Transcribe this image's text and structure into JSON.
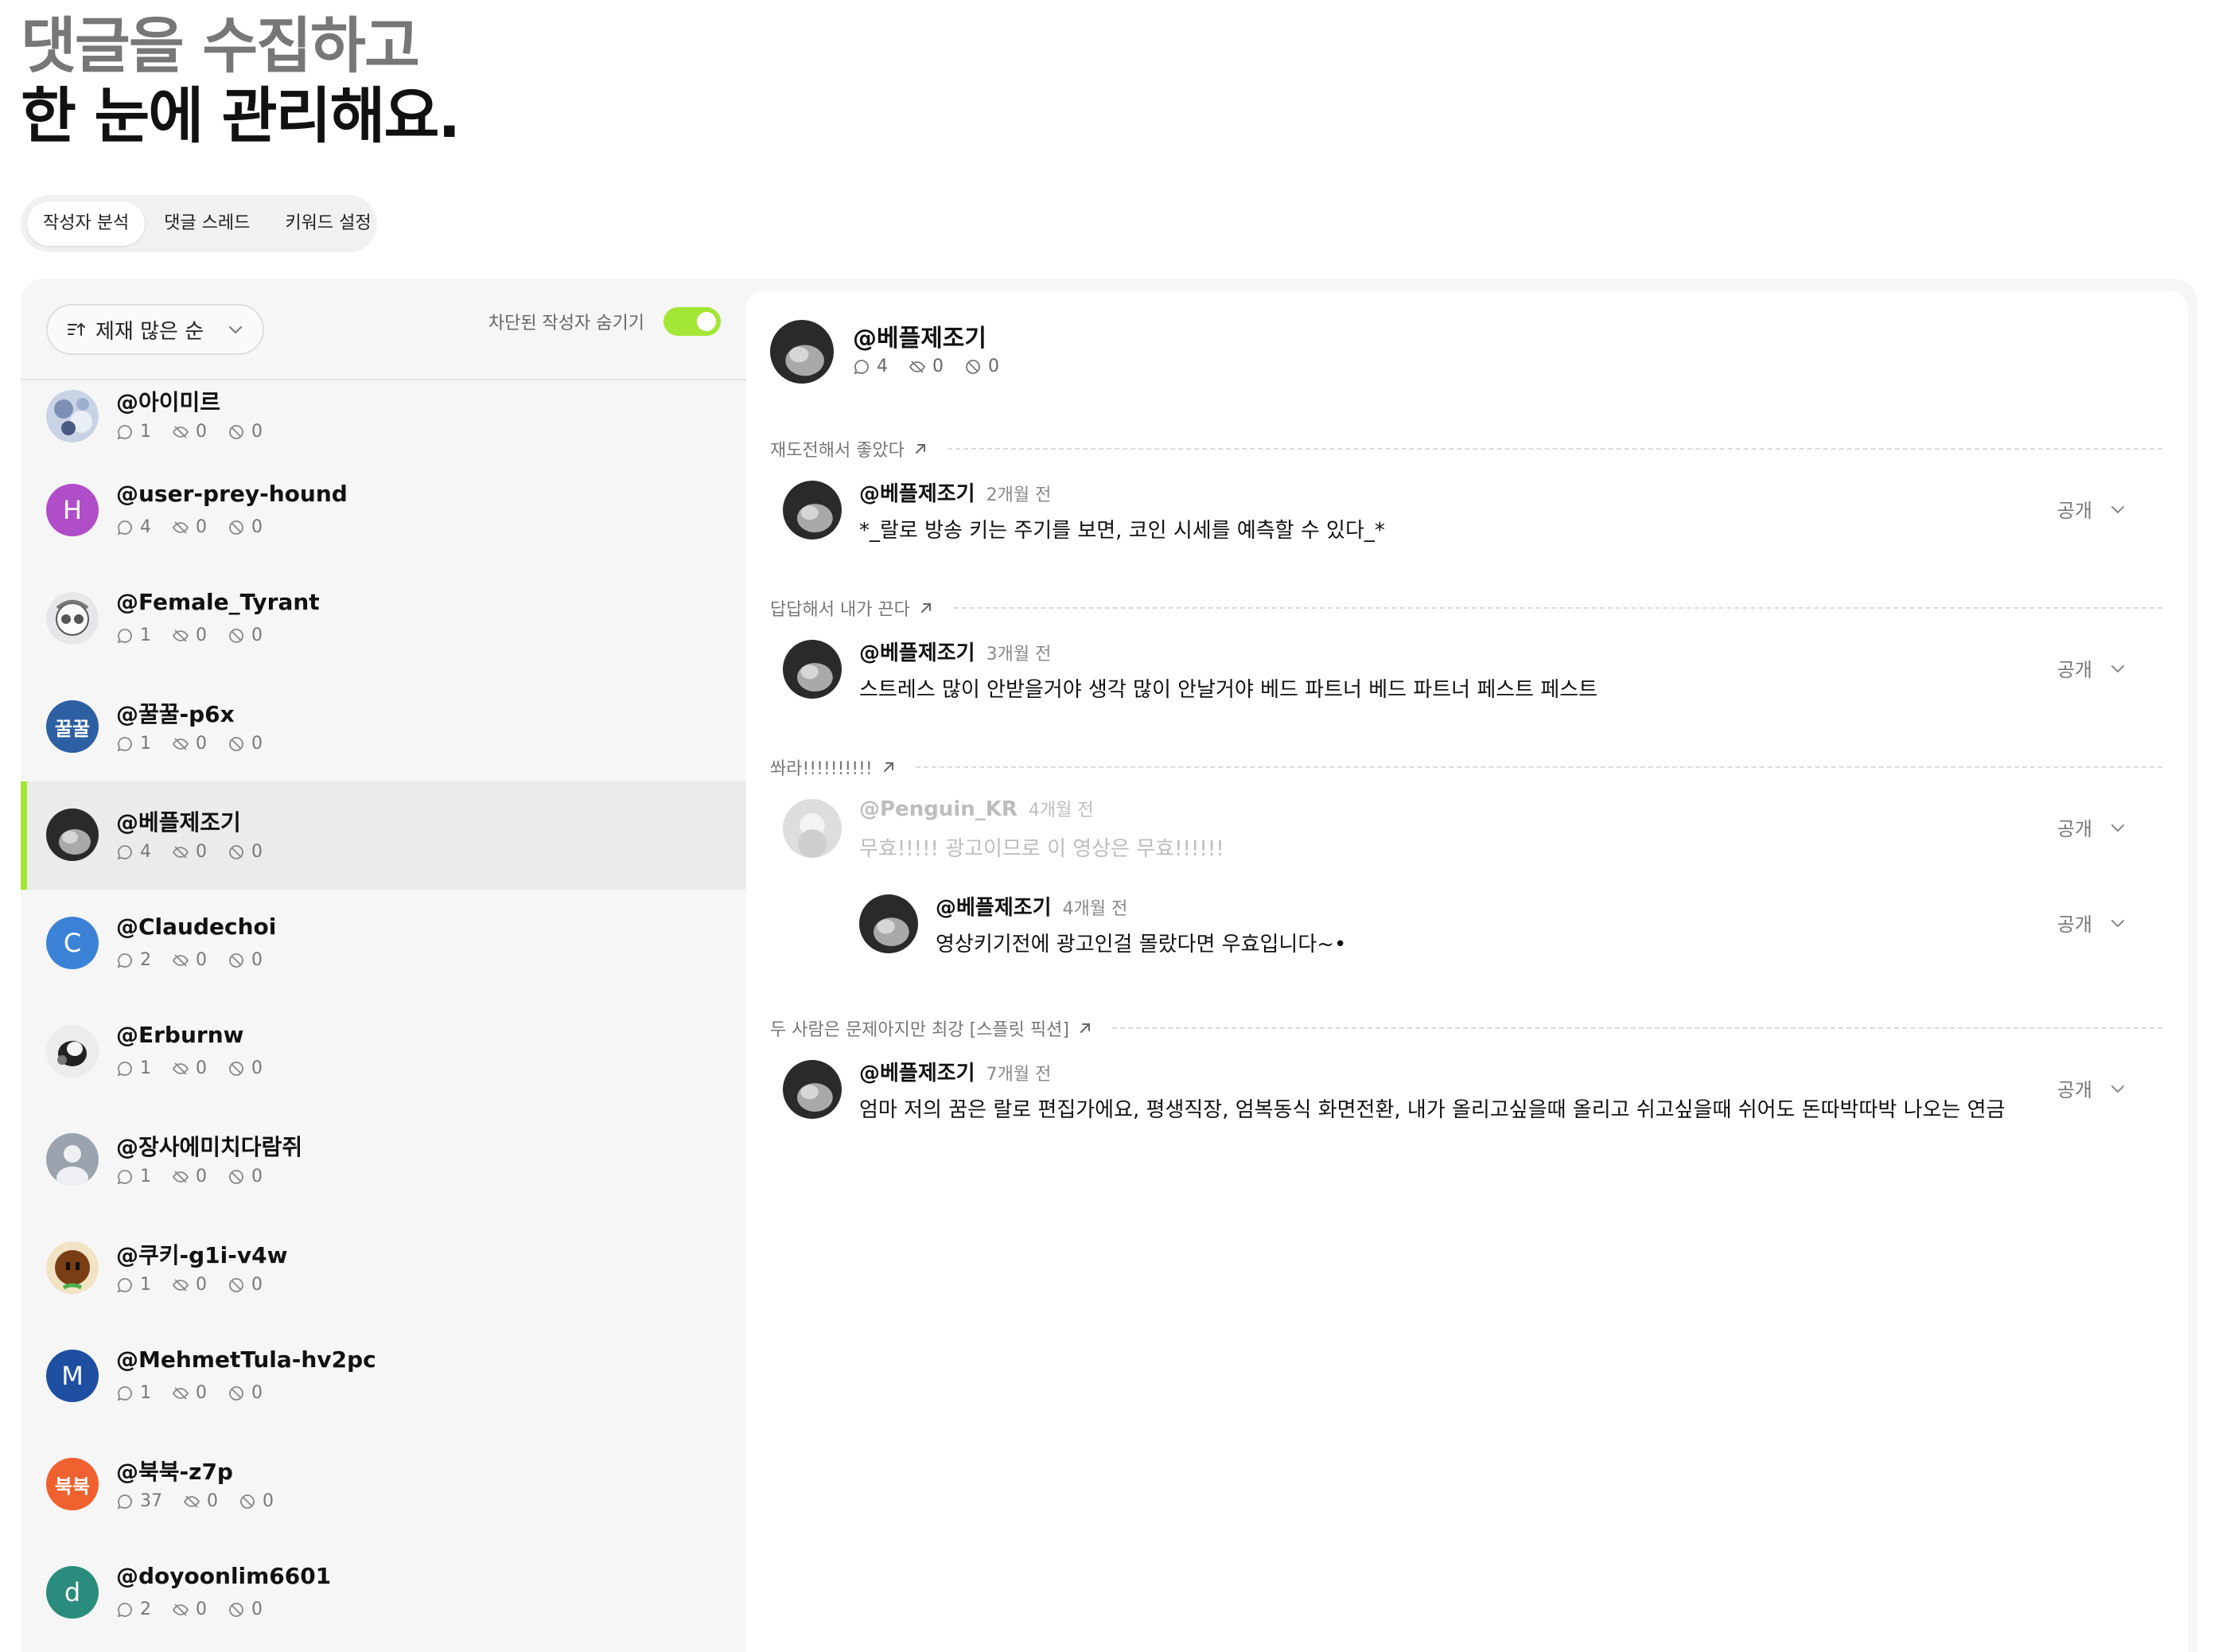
{
  "hero": {
    "line1": "댓글을 수집하고",
    "line2": "한 눈에 관리해요."
  },
  "tabs": [
    {
      "label": "작성자 분석",
      "active": true
    },
    {
      "label": "댓글 스레드",
      "active": false
    },
    {
      "label": "키워드 설정",
      "active": false
    }
  ],
  "left_panel": {
    "sort_label": "제재 많은 순",
    "toggle_label": "차단된 작성자 숨기기",
    "toggle_on": true,
    "accent_color": "#a3e635",
    "authors": [
      {
        "name": "@아이미르",
        "comments": "1",
        "hidden": "0",
        "blocked": "0",
        "avatar": "photo-crystal"
      },
      {
        "name": "@user-prey-hound",
        "comments": "4",
        "hidden": "0",
        "blocked": "0",
        "avatar_letter": "H",
        "avatar_color": "#b04ec9"
      },
      {
        "name": "@Female_Tyrant",
        "comments": "1",
        "hidden": "0",
        "blocked": "0",
        "avatar": "photo-anime"
      },
      {
        "name": "@꿀꿀-p6x",
        "comments": "1",
        "hidden": "0",
        "blocked": "0",
        "avatar_letter": "꿀꿀",
        "avatar_color": "#2d5fa3"
      },
      {
        "name": "@베플제조기",
        "comments": "4",
        "hidden": "0",
        "blocked": "0",
        "avatar": "photo-dark",
        "selected": true
      },
      {
        "name": "@Claudechoi",
        "comments": "2",
        "hidden": "0",
        "blocked": "0",
        "avatar_letter": "C",
        "avatar_color": "#3b82d6"
      },
      {
        "name": "@Erburnw",
        "comments": "1",
        "hidden": "0",
        "blocked": "0",
        "avatar": "photo-dog"
      },
      {
        "name": "@장사에미치다람쥐",
        "comments": "1",
        "hidden": "0",
        "blocked": "0",
        "avatar": "default-person"
      },
      {
        "name": "@쿠키-g1i-v4w",
        "comments": "1",
        "hidden": "0",
        "blocked": "0",
        "avatar": "photo-cookie"
      },
      {
        "name": "@MehmetTula-hv2pc",
        "comments": "1",
        "hidden": "0",
        "blocked": "0",
        "avatar_letter": "M",
        "avatar_color": "#1e4fa0"
      },
      {
        "name": "@북북-z7p",
        "comments": "37",
        "hidden": "0",
        "blocked": "0",
        "avatar_letter": "북북",
        "avatar_color": "#f0612f"
      },
      {
        "name": "@doyoonlim6601",
        "comments": "2",
        "hidden": "0",
        "blocked": "0",
        "avatar_letter": "d",
        "avatar_color": "#2a8c7c"
      }
    ]
  },
  "detail": {
    "name": "@베플제조기",
    "comments": "4",
    "hidden": "0",
    "blocked": "0",
    "threads": [
      {
        "video_title": "재도전해서 좋았다",
        "comments": [
          {
            "author": "@베플제조기",
            "time": "2개월 전",
            "text": "*_랄로 방송 키는 주기를 보면, 코인 시세를 예측할 수 있다_*",
            "visibility": "공개"
          }
        ]
      },
      {
        "video_title": "답답해서 내가 끈다",
        "comments": [
          {
            "author": "@베플제조기",
            "time": "3개월 전",
            "text": "스트레스 많이 안받을거야 생각 많이 안날거야 베드 파트너 베드 파트너 페스트 페스트",
            "visibility": "공개"
          }
        ]
      },
      {
        "video_title": "쏴라!!!!!!!!!!",
        "comments": [
          {
            "author": "@Penguin_KR",
            "time": "4개월 전",
            "text": "무효!!!!! 광고이므로 이 영상은 무효!!!!!!",
            "visibility": "공개",
            "faded": true
          },
          {
            "author": "@베플제조기",
            "time": "4개월 전",
            "text": "영상키기전에 광고인걸 몰랐다면 우효입니다~•",
            "visibility": "공개",
            "reply": true
          }
        ]
      },
      {
        "video_title": "두 사람은 문제아지만 최강 [스플릿 픽션]",
        "comments": [
          {
            "author": "@베플제조기",
            "time": "7개월 전",
            "text": "엄마 저의 꿈은 랄로 편집가에요, 평생직장, 엄복동식 화면전환, 내가 올리고싶을때 올리고 쉬고싶을때 쉬어도 돈따박따박 나오는 연금",
            "visibility": "공개"
          }
        ]
      }
    ]
  }
}
